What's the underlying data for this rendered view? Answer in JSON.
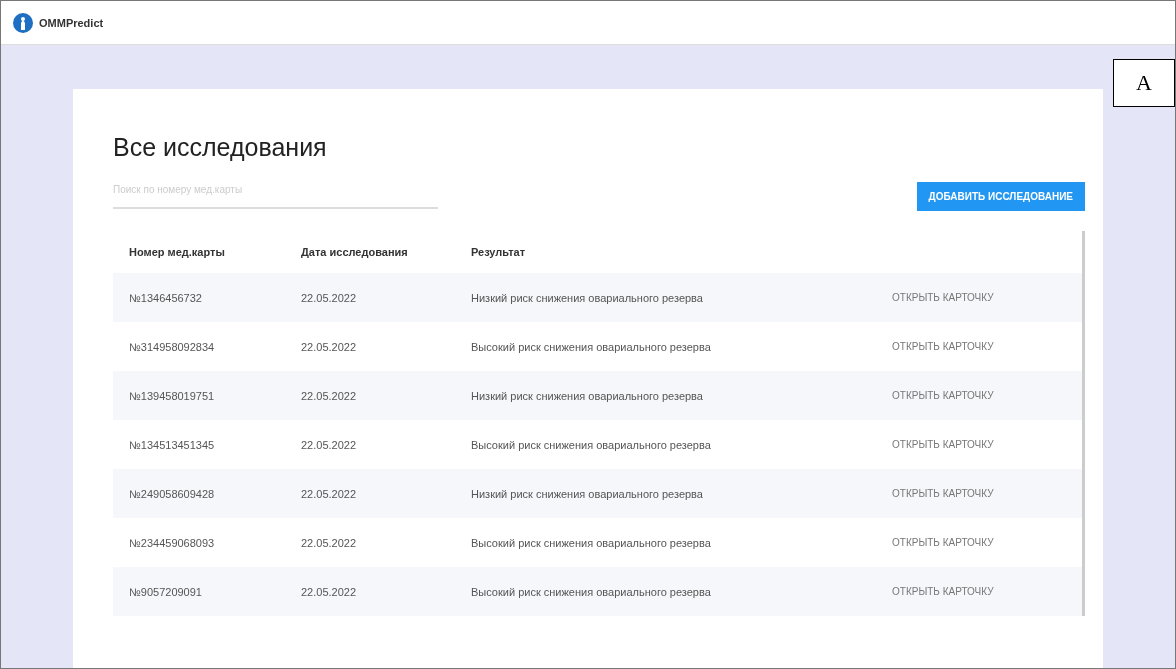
{
  "app": {
    "name": "OMMPredict"
  },
  "figure_label": "A",
  "page": {
    "title": "Все исследования"
  },
  "search": {
    "placeholder": "Поиск по номеру мед.карты"
  },
  "add_button": {
    "label": "ДОБАВИТЬ ИССЛЕДОВАНИЕ"
  },
  "table": {
    "columns": [
      "Номер мед.карты",
      "Дата исследования",
      "Результат"
    ],
    "rows": [
      {
        "card": "№1346456732",
        "date": "22.05.2022",
        "result": "Низкий риск снижения овариального резерва",
        "action": "ОТКРЫТЬ КАРТОЧКУ"
      },
      {
        "card": "№314958092834",
        "date": "22.05.2022",
        "result": "Высокий риск снижения овариального резерва",
        "action": "ОТКРЫТЬ КАРТОЧКУ"
      },
      {
        "card": "№139458019751",
        "date": "22.05.2022",
        "result": "Низкий риск снижения овариального резерва",
        "action": "ОТКРЫТЬ КАРТОЧКУ"
      },
      {
        "card": "№134513451345",
        "date": "22.05.2022",
        "result": "Высокий риск снижения овариального резерва",
        "action": "ОТКРЫТЬ КАРТОЧКУ"
      },
      {
        "card": "№249058609428",
        "date": "22.05.2022",
        "result": "Низкий риск снижения овариального резерва",
        "action": "ОТКРЫТЬ КАРТОЧКУ"
      },
      {
        "card": "№234459068093",
        "date": "22.05.2022",
        "result": "Высокий риск снижения овариального резерва",
        "action": "ОТКРЫТЬ КАРТОЧКУ"
      },
      {
        "card": "№9057209091",
        "date": "22.05.2022",
        "result": "Высокий риск снижения овариального резерва",
        "action": "ОТКРЫТЬ КАРТОЧКУ"
      }
    ]
  }
}
